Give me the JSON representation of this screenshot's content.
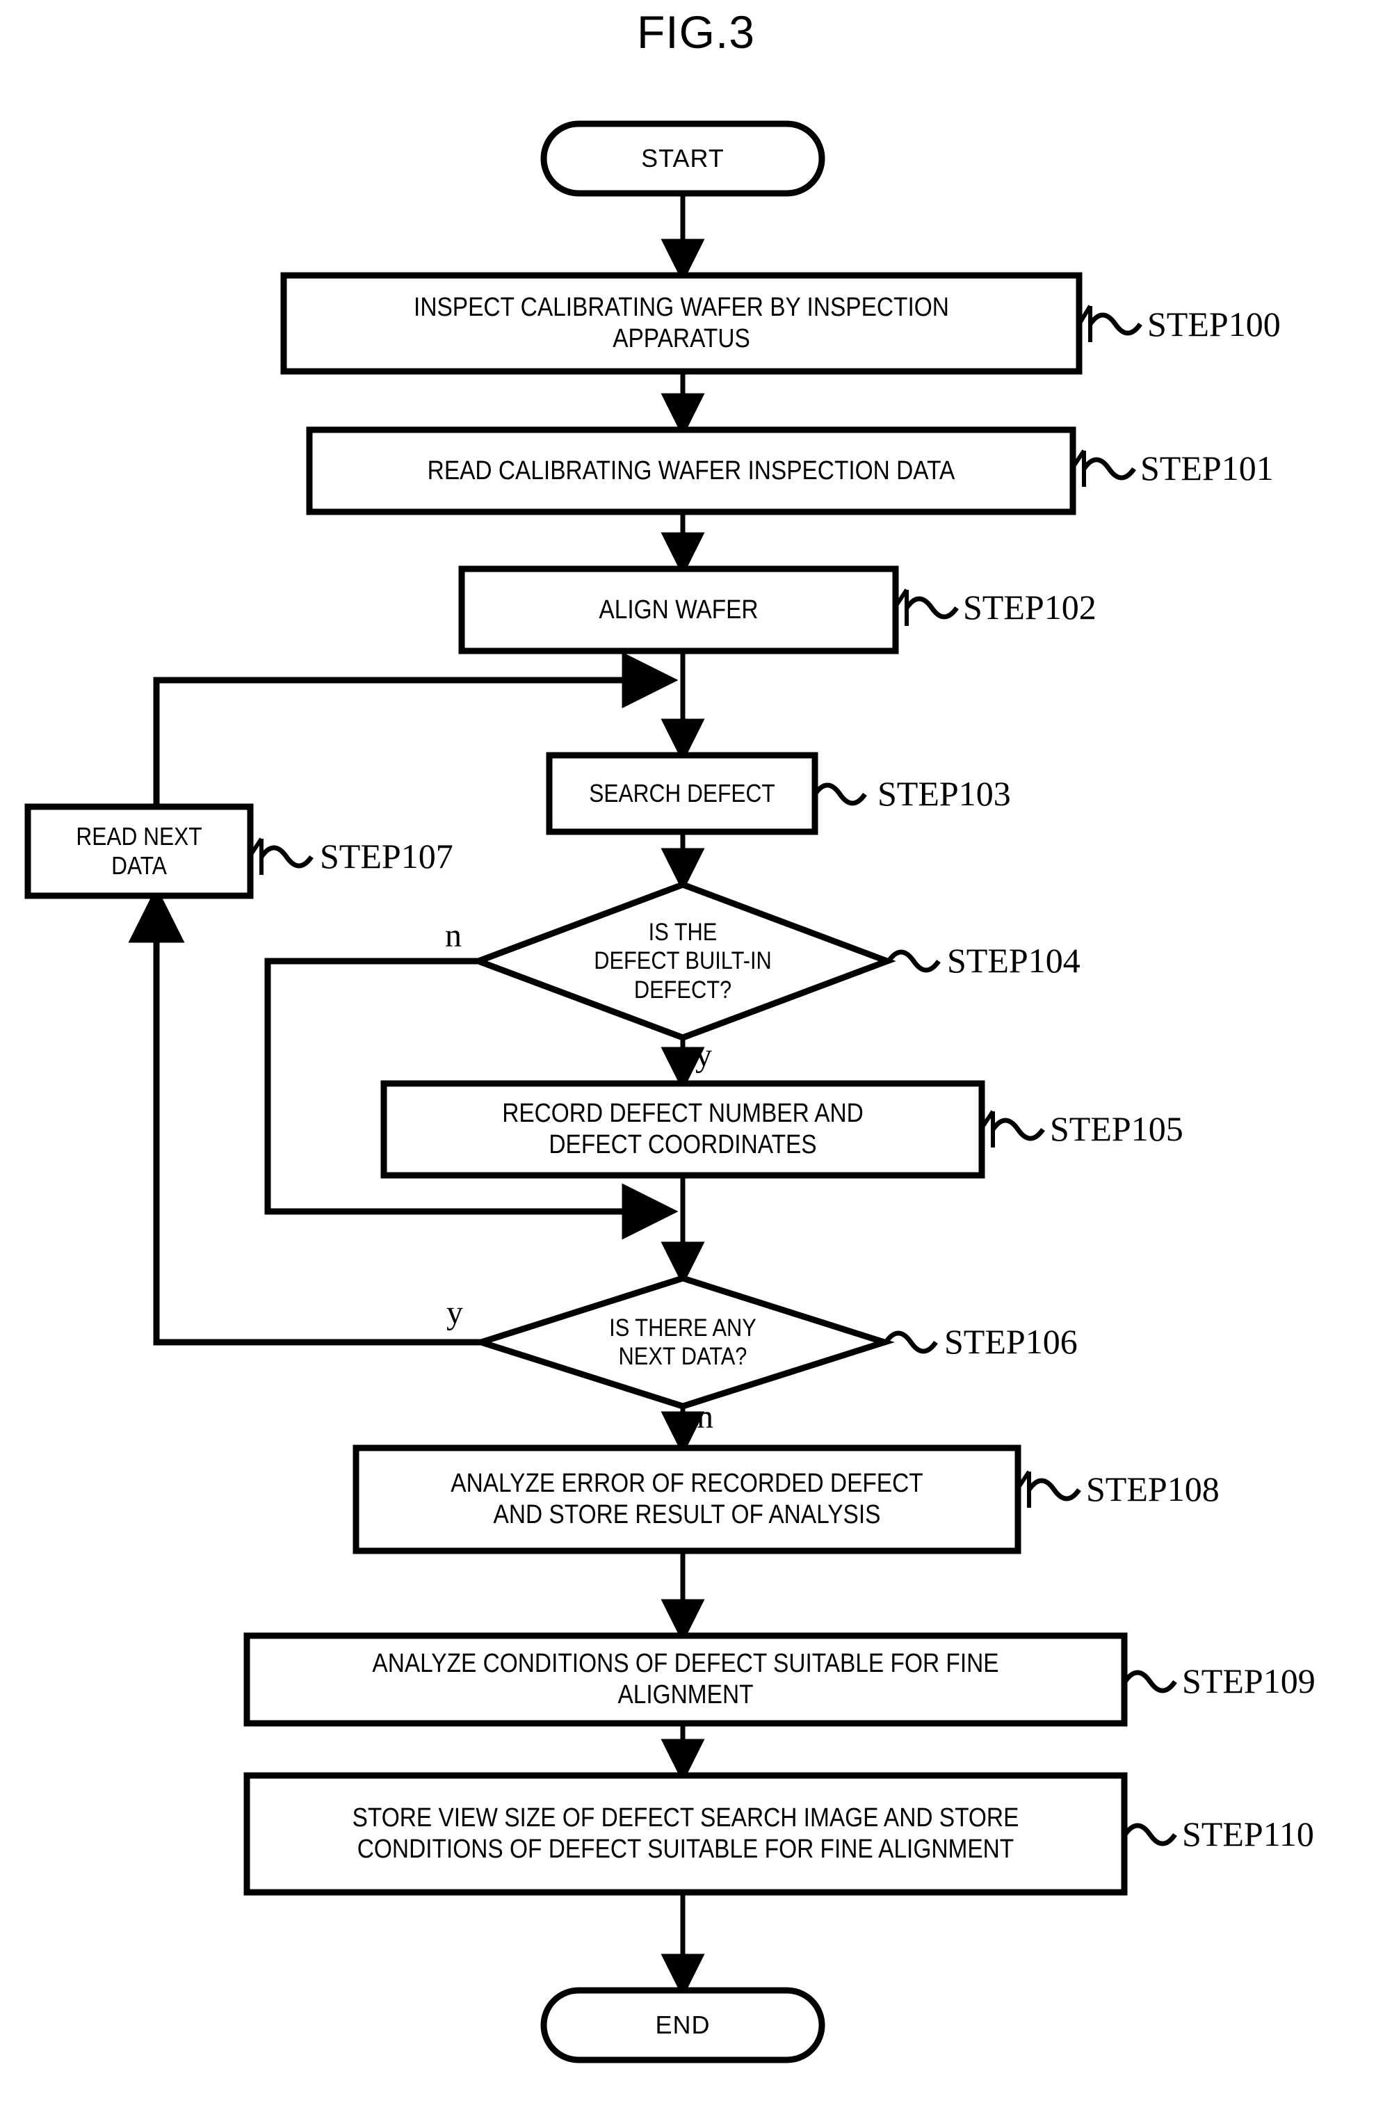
{
  "figure": {
    "title": "FIG.3",
    "type": "flowchart"
  },
  "nodes": {
    "start": {
      "label": "START",
      "shape": "terminal"
    },
    "step100": {
      "label": "INSPECT CALIBRATING WAFER BY INSPECTION\nAPPARATUS",
      "shape": "process",
      "ref": "STEP100"
    },
    "step101": {
      "label": "READ CALIBRATING WAFER INSPECTION DATA",
      "shape": "process",
      "ref": "STEP101"
    },
    "step102": {
      "label": "ALIGN WAFER",
      "shape": "process",
      "ref": "STEP102"
    },
    "step103": {
      "label": "SEARCH DEFECT",
      "shape": "process",
      "ref": "STEP103"
    },
    "step104": {
      "label": "IS THE\nDEFECT BUILT-IN\nDEFECT?",
      "shape": "decision",
      "ref": "STEP104"
    },
    "step105": {
      "label": "RECORD DEFECT NUMBER AND\nDEFECT COORDINATES",
      "shape": "process",
      "ref": "STEP105"
    },
    "step106": {
      "label": "IS THERE ANY\nNEXT DATA?",
      "shape": "decision",
      "ref": "STEP106"
    },
    "step107": {
      "label": "READ NEXT\nDATA",
      "shape": "process",
      "ref": "STEP107"
    },
    "step108": {
      "label": "ANALYZE ERROR OF RECORDED DEFECT\nAND STORE RESULT OF ANALYSIS",
      "shape": "process",
      "ref": "STEP108"
    },
    "step109": {
      "label": "ANALYZE CONDITIONS OF DEFECT SUITABLE FOR FINE\nALIGNMENT",
      "shape": "process",
      "ref": "STEP109"
    },
    "step110": {
      "label": "STORE VIEW SIZE OF DEFECT SEARCH IMAGE AND STORE\nCONDITIONS OF DEFECT SUITABLE FOR FINE ALIGNMENT",
      "shape": "process",
      "ref": "STEP110"
    },
    "end": {
      "label": "END",
      "shape": "terminal"
    }
  },
  "branch_labels": {
    "step104_no": "n",
    "step104_yes": "y",
    "step106_yes": "y",
    "step106_no": "n"
  },
  "colors": {
    "stroke": "#000000",
    "fill": "#ffffff",
    "background": "#ffffff"
  }
}
